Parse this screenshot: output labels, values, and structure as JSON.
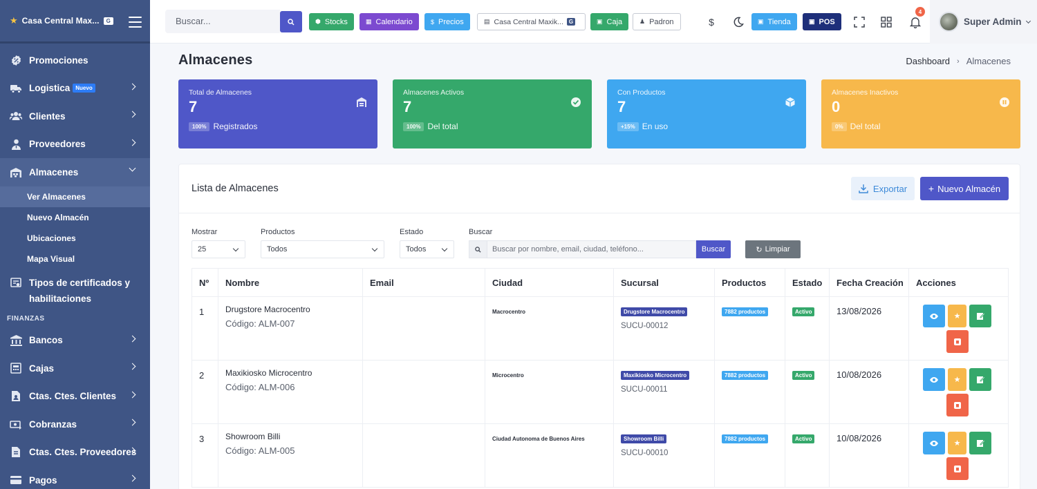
{
  "sidebar": {
    "brand": "Casa Central Max...",
    "brand_badge": "G",
    "items": [
      {
        "label": "Promociones"
      },
      {
        "label": "Logistica",
        "badge": "Nuevo"
      },
      {
        "label": "Clientes"
      },
      {
        "label": "Proveedores"
      },
      {
        "label": "Almacenes"
      }
    ],
    "sub_items": [
      {
        "label": "Ver Almacenes"
      },
      {
        "label": "Nuevo Almacén"
      },
      {
        "label": "Ubicaciones"
      },
      {
        "label": "Mapa Visual"
      }
    ],
    "certs": "Tipos de certificados y habilitaciones",
    "section_finanzas": "FINANZAS",
    "fin_items": [
      {
        "label": "Bancos"
      },
      {
        "label": "Cajas"
      },
      {
        "label": "Ctas. Ctes. Clientes"
      },
      {
        "label": "Cobranzas"
      },
      {
        "label": "Ctas. Ctes. Proveedores"
      },
      {
        "label": "Pagos"
      }
    ]
  },
  "topbar": {
    "search_placeholder": "Buscar...",
    "buttons": {
      "stocks": "Stocks",
      "calendario": "Calendario",
      "precios": "Precios",
      "sucursal": "Casa Central Maxik...",
      "sucursal_badge": "G",
      "caja": "Caja",
      "padron": "Padron",
      "tienda": "Tienda",
      "pos": "POS"
    },
    "notifications": "4",
    "user": "Super Admin"
  },
  "page": {
    "title": "Almacenes",
    "breadcrumb": [
      "Dashboard",
      "Almacenes"
    ]
  },
  "cards": [
    {
      "label": "Total de Almacenes",
      "value": "7",
      "pill": "100%",
      "foot": "Registrados",
      "color": "#4f57c8"
    },
    {
      "label": "Almacenes Activos",
      "value": "7",
      "pill": "100%",
      "foot": "Del total",
      "color": "#35a86b"
    },
    {
      "label": "Con Productos",
      "value": "7",
      "pill": "+15%",
      "foot": "En uso",
      "color": "#3fa7f0"
    },
    {
      "label": "Almacenes Inactivos",
      "value": "0",
      "pill": "0%",
      "foot": "Del total",
      "color": "#f7b84b"
    }
  ],
  "list": {
    "title": "Lista de Almacenes",
    "export": "Exportar",
    "new": "Nuevo Almacén",
    "filters": {
      "mostrar_label": "Mostrar",
      "mostrar_value": "25",
      "productos_label": "Productos",
      "productos_value": "Todos",
      "estado_label": "Estado",
      "estado_value": "Todos",
      "buscar_label": "Buscar",
      "buscar_placeholder": "Buscar por nombre, email, ciudad, teléfono...",
      "buscar_btn": "Buscar",
      "limpiar_btn": "Limpiar"
    },
    "columns": [
      "Nº",
      "Nombre",
      "Email",
      "Ciudad",
      "Sucursal",
      "Productos",
      "Estado",
      "Fecha Creación",
      "Acciones"
    ],
    "rows": [
      {
        "n": "1",
        "name": "Drugstore Macrocentro",
        "code": "Código: ALM-007",
        "email": "",
        "city": "Macrocentro",
        "sucursal": "Drugstore Macrocentro",
        "sucursal_code": "SUCU-00012",
        "productos": "7882 productos",
        "estado": "Activo",
        "fecha": "13/08/2026"
      },
      {
        "n": "2",
        "name": "Maxikiosko Microcentro",
        "code": "Código: ALM-006",
        "email": "",
        "city": "Microcentro",
        "sucursal": "Maxikiosko Microcentro",
        "sucursal_code": "SUCU-00011",
        "productos": "7882 productos",
        "estado": "Activo",
        "fecha": "10/08/2026"
      },
      {
        "n": "3",
        "name": "Showroom Billi",
        "code": "Código: ALM-005",
        "email": "",
        "city": "Ciudad Autonoma de Buenos Aires",
        "sucursal": "Showroom Billi",
        "sucursal_code": "SUCU-00010",
        "productos": "7882 productos",
        "estado": "Activo",
        "fecha": "10/08/2026"
      }
    ]
  }
}
